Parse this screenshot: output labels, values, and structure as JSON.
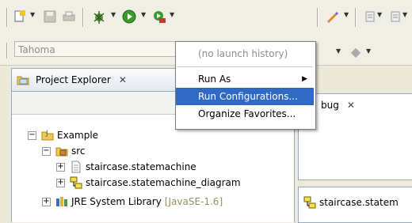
{
  "toolbar": {
    "icons": [
      "new-icon",
      "save-icon",
      "print-icon",
      "debug-icon",
      "run-icon",
      "external-tools-icon",
      "pen-icon",
      "nav-icon"
    ]
  },
  "font_selector": {
    "value": "Tahoma"
  },
  "launch_menu": {
    "items": [
      {
        "label": "(no launch history)",
        "state": "disabled"
      },
      {
        "label": "Run As",
        "state": "submenu"
      },
      {
        "label": "Run Configurations...",
        "state": "highlighted"
      },
      {
        "label": "Organize Favorites...",
        "state": "normal"
      }
    ]
  },
  "project_explorer": {
    "tab_label": "Project Explorer",
    "close_symbol": "✕",
    "tree": {
      "project": "Example",
      "src_folder": "src",
      "file1": "staircase.statemachine",
      "file2": "staircase.statemachine_diagram",
      "library": "JRE System Library",
      "library_version": "[JavaSE-1.6]"
    }
  },
  "debug_view": {
    "tab_label": "bug",
    "close_symbol": "✕"
  },
  "editor_tab": {
    "label": "staircase.statem"
  },
  "colors": {
    "menu_highlight": "#316ac5",
    "view_border": "#8fa7c9",
    "chrome": "#ece9d8"
  }
}
